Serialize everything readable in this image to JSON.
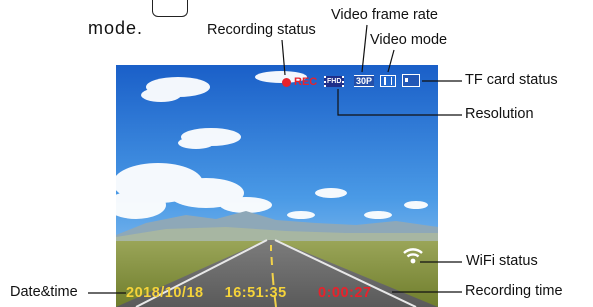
{
  "intro": {
    "text": "mode."
  },
  "callouts": {
    "recording_status": "Recording status",
    "video_frame_rate": "Video frame rate",
    "video_mode": "Video mode",
    "tf_card_status": "TF card status",
    "resolution": "Resolution",
    "wifi_status": "WiFi status",
    "date_time": "Date&time",
    "recording_time": "Recording time"
  },
  "screen": {
    "rec_label": "REC",
    "resolution_badge": "FHD",
    "frame_rate_badge": "30P",
    "date": "2018/10/18",
    "clock": "16:51:35",
    "elapsed": "0:00:27",
    "icons": [
      "record-dot-icon",
      "fhd-icon",
      "frame-rate-icon",
      "video-mode-icon",
      "tf-card-icon",
      "wifi-icon"
    ]
  },
  "colors": {
    "rec_red": "#e8222b",
    "date_yellow": "#f5d33a",
    "sky_top": "#1f6fd6",
    "grass": "#8a9a3a"
  }
}
